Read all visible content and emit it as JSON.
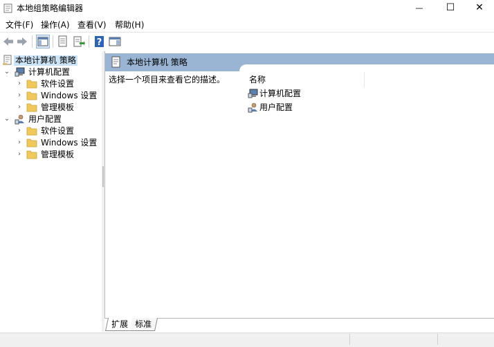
{
  "window": {
    "title": "本地组策略编辑器",
    "minimize_glyph": "—",
    "maximize_glyph": "☐",
    "close_glyph": "✕"
  },
  "menu": {
    "items": [
      {
        "label": "文件(F)"
      },
      {
        "label": "操作(A)"
      },
      {
        "label": "查看(V)"
      },
      {
        "label": "帮助(H)"
      }
    ]
  },
  "toolbar": {
    "icons": [
      "back-arrow-icon",
      "forward-arrow-icon",
      "show-hide-console-tree-icon",
      "properties-icon",
      "export-list-icon",
      "help-icon",
      "show-action-pane-icon"
    ]
  },
  "tree": {
    "root": {
      "label": "本地计算机 策略"
    },
    "computer": {
      "label": "计算机配置"
    },
    "computer_children": [
      {
        "label": "软件设置"
      },
      {
        "label": "Windows 设置"
      },
      {
        "label": "管理模板"
      }
    ],
    "user": {
      "label": "用户配置"
    },
    "user_children": [
      {
        "label": "软件设置"
      },
      {
        "label": "Windows 设置"
      },
      {
        "label": "管理模板"
      }
    ]
  },
  "detail": {
    "header_title": "本地计算机 策略",
    "description": "选择一个项目来查看它的描述。",
    "column_name": "名称",
    "items": [
      {
        "label": "计算机配置"
      },
      {
        "label": "用户配置"
      }
    ]
  },
  "tabs": [
    {
      "label": "扩展"
    },
    {
      "label": "标准"
    }
  ],
  "colors": {
    "header_blue": "#9ab5d3",
    "selection": "#cce4f7",
    "folder_yellow": "#f1c85a"
  }
}
